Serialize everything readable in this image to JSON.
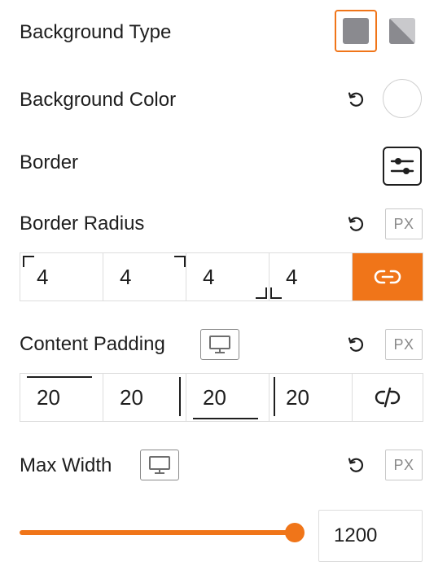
{
  "background_type": {
    "label": "Background Type",
    "options": [
      {
        "name": "solid",
        "icon": "solid-color-swatch-icon",
        "active": true
      },
      {
        "name": "gradient",
        "icon": "gradient-swatch-icon",
        "active": false
      }
    ]
  },
  "background_color": {
    "label": "Background Color",
    "reset_icon": "reset-icon",
    "value": "#ffffff"
  },
  "border": {
    "label": "Border",
    "icon": "sliders-icon"
  },
  "border_radius": {
    "label": "Border Radius",
    "unit": "PX",
    "values": [
      "4",
      "4",
      "4",
      "4"
    ],
    "linked": true,
    "link_icon": "link-icon"
  },
  "content_padding": {
    "label": "Content Padding",
    "device_icon": "desktop-icon",
    "unit": "PX",
    "values": [
      "20",
      "20",
      "20",
      "20"
    ],
    "linked": false,
    "link_icon": "unlink-icon"
  },
  "max_width": {
    "label": "Max Width",
    "device_icon": "desktop-icon",
    "unit": "PX",
    "value": "1200",
    "slider_level": 1.0
  },
  "colors": {
    "accent": "#f07519",
    "text": "#1e1e1e",
    "muted": "#8a8a8a",
    "border": "#dddddd",
    "swatch": "#8a8a8f"
  }
}
